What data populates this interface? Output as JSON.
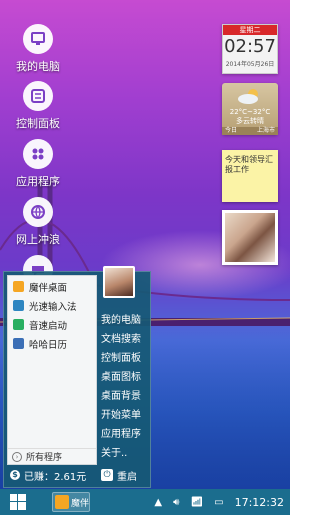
{
  "desktop": {
    "icons": [
      {
        "label": "我的电脑",
        "icon": "computer-icon"
      },
      {
        "label": "控制面板",
        "icon": "control-panel-icon"
      },
      {
        "label": "应用程序",
        "icon": "apps-icon"
      },
      {
        "label": "网上冲浪",
        "icon": "globe-icon"
      }
    ]
  },
  "widgets": {
    "calendar": {
      "weekday": "星期二",
      "time": "02:57",
      "date": "2014年05月26日"
    },
    "weather": {
      "temp": "22°C~32°C",
      "desc": "多云转晴",
      "today": "今日",
      "city": "上海市"
    },
    "note": {
      "text": "今天和领导汇报工作"
    }
  },
  "start_menu": {
    "programs": [
      {
        "label": "魔伴桌面",
        "icon": "pinwheel-icon",
        "color": "#f5a623"
      },
      {
        "label": "光速输入法",
        "icon": "g-keyboard-icon",
        "color": "#2e86c1"
      },
      {
        "label": "音速启动",
        "icon": "v-launcher-icon",
        "color": "#27ae60"
      },
      {
        "label": "哈哈日历",
        "icon": "calendar-icon",
        "color": "#3b6fb6"
      }
    ],
    "all_programs": "所有程序",
    "links": [
      "我的电脑",
      "文档搜索",
      "控制面板",
      "桌面图标",
      "桌面背景",
      "开始菜单",
      "应用程序",
      "关于.."
    ],
    "earned": "已赚：2.61元",
    "restart": "重启"
  },
  "taskbar": {
    "app_label": "魔伴",
    "clock": "17:12:32"
  }
}
